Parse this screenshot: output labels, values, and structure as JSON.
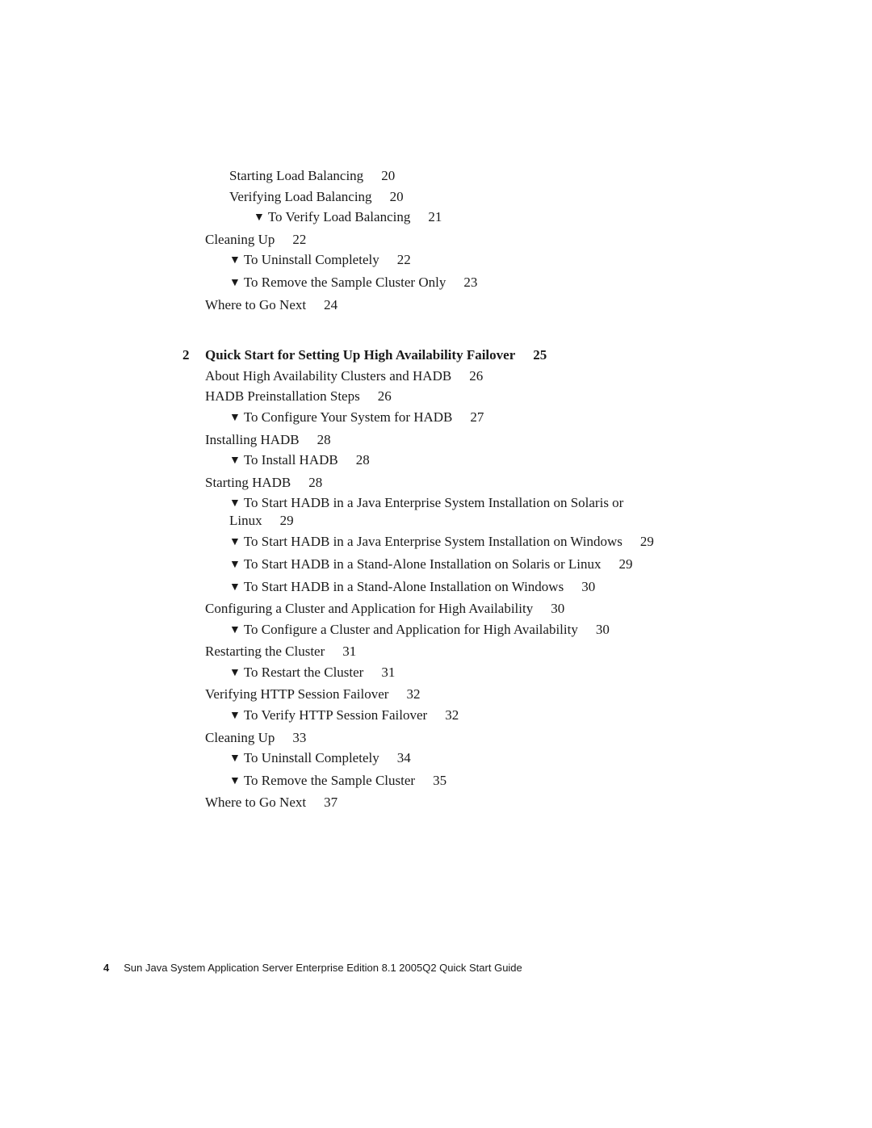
{
  "toc": {
    "pre_entries": [
      {
        "type": "section",
        "level": 2,
        "title": "Starting Load Balancing",
        "page": "20"
      },
      {
        "type": "section",
        "level": 2,
        "title": "Verifying Load Balancing",
        "page": "20"
      },
      {
        "type": "task",
        "level": 3,
        "title": "To Verify Load Balancing",
        "page": "21"
      },
      {
        "type": "section",
        "level": 1,
        "title": "Cleaning Up",
        "page": "22"
      },
      {
        "type": "task",
        "level": 2,
        "title": "To Uninstall Completely",
        "page": "22"
      },
      {
        "type": "task",
        "level": 2,
        "title": "To Remove the Sample Cluster Only",
        "page": "23"
      },
      {
        "type": "section",
        "level": 1,
        "title": "Where to Go Next",
        "page": "24"
      }
    ],
    "chapter": {
      "number": "2",
      "title": "Quick Start for Setting Up High Availability Failover",
      "page": "25"
    },
    "chapter_entries": [
      {
        "type": "section",
        "level": 1,
        "title": "About High Availability Clusters and HADB",
        "page": "26"
      },
      {
        "type": "section",
        "level": 1,
        "title": "HADB Preinstallation Steps",
        "page": "26"
      },
      {
        "type": "task",
        "level": 2,
        "title": "To Configure Your System for HADB",
        "page": "27"
      },
      {
        "type": "section",
        "level": 1,
        "title": "Installing HADB",
        "page": "28"
      },
      {
        "type": "task",
        "level": 2,
        "title": "To Install HADB",
        "page": "28"
      },
      {
        "type": "section",
        "level": 1,
        "title": "Starting HADB",
        "page": "28"
      },
      {
        "type": "task",
        "level": 2,
        "title": "To Start HADB in a Java Enterprise System Installation on Solaris or",
        "continuation": "Linux",
        "page": "29"
      },
      {
        "type": "task",
        "level": 2,
        "title": "To Start HADB in a Java Enterprise System Installation on Windows",
        "page": "29"
      },
      {
        "type": "task",
        "level": 2,
        "title": "To Start HADB in a Stand-Alone Installation on Solaris or Linux",
        "page": "29"
      },
      {
        "type": "task",
        "level": 2,
        "title": "To Start HADB in a Stand-Alone Installation on Windows",
        "page": "30"
      },
      {
        "type": "section",
        "level": 1,
        "title": "Configuring a Cluster and Application for High Availability",
        "page": "30"
      },
      {
        "type": "task",
        "level": 2,
        "title": "To Configure a Cluster and Application for High Availability",
        "page": "30"
      },
      {
        "type": "section",
        "level": 1,
        "title": "Restarting the Cluster",
        "page": "31"
      },
      {
        "type": "task",
        "level": 2,
        "title": "To Restart the Cluster",
        "page": "31"
      },
      {
        "type": "section",
        "level": 1,
        "title": "Verifying HTTP Session Failover",
        "page": "32"
      },
      {
        "type": "task",
        "level": 2,
        "title": "To Verify HTTP Session Failover",
        "page": "32"
      },
      {
        "type": "section",
        "level": 1,
        "title": "Cleaning Up",
        "page": "33"
      },
      {
        "type": "task",
        "level": 2,
        "title": "To Uninstall Completely",
        "page": "34"
      },
      {
        "type": "task",
        "level": 2,
        "title": "To Remove the Sample Cluster",
        "page": "35"
      },
      {
        "type": "section",
        "level": 1,
        "title": "Where to Go Next",
        "page": "37"
      }
    ],
    "task_marker": "▼"
  },
  "footer": {
    "page_number": "4",
    "book_title": "Sun Java System Application Server Enterprise Edition 8.1 2005Q2 Quick Start Guide"
  }
}
